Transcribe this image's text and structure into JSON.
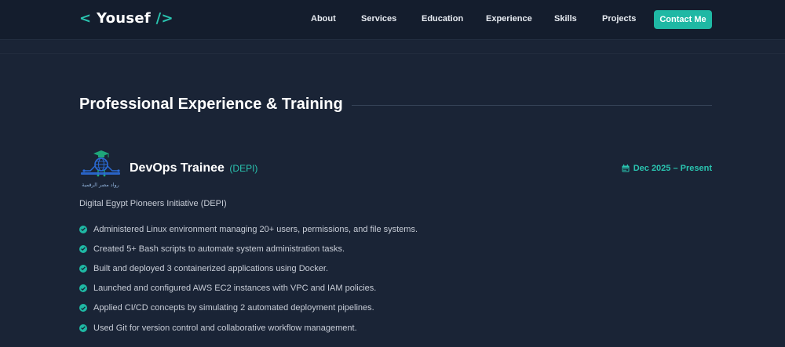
{
  "brand": {
    "open": "< ",
    "name": "Yousef",
    "close": " />",
    "accent_color": "#2ac4b0"
  },
  "nav": {
    "links": [
      "About",
      "Services",
      "Education",
      "Experience",
      "Skills",
      "Projects"
    ],
    "contact_label": "Contact Me"
  },
  "section": {
    "title": "Professional Experience & Training"
  },
  "experience": {
    "role": "DevOps Trainee",
    "org_short": "(DEPI)",
    "date_icon": "calendar-icon",
    "date": "Dec 2025 – Present",
    "org_name": "Digital Egypt Pioneers Initiative (DEPI)",
    "logo_caption": "رواد مصر الرقمية",
    "bullet_icon": "check-circle-icon",
    "bullets": [
      "Administered Linux environment managing 20+ users, permissions, and file systems.",
      "Created 5+ Bash scripts to automate system administration tasks.",
      "Built and deployed 3 containerized applications using Docker.",
      "Launched and configured AWS EC2 instances with VPC and IAM policies.",
      "Applied CI/CD concepts by simulating 2 automated deployment pipelines.",
      "Used Git for version control and collaborative workflow management."
    ]
  }
}
